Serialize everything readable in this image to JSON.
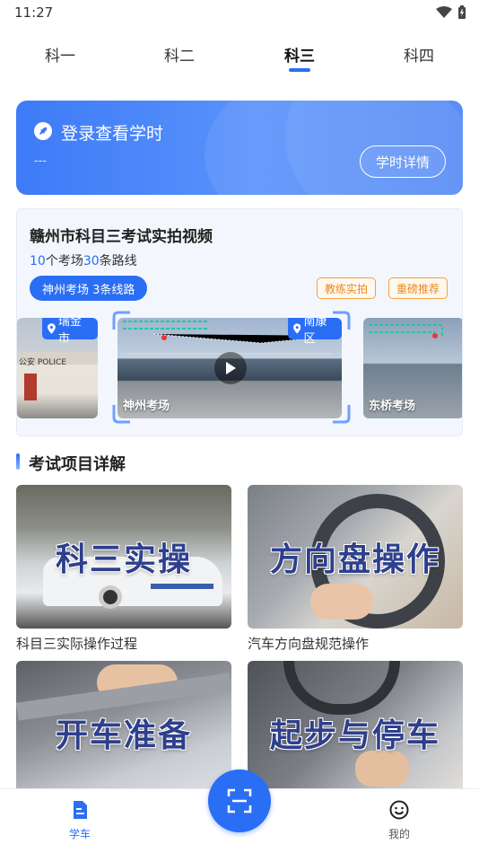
{
  "status_bar": {
    "time": "11:27"
  },
  "tabs": [
    {
      "label": "科一"
    },
    {
      "label": "科二"
    },
    {
      "label": "科三"
    },
    {
      "label": "科四"
    }
  ],
  "active_tab": "科三",
  "login_card": {
    "title": "登录查看学时",
    "subtitle": "---",
    "button": "学时详情"
  },
  "video_card": {
    "title": "赣州市科目三考试实拍视频",
    "stats": {
      "venues_count": "10",
      "venues_text": "个考场",
      "routes_count": "30",
      "routes_text": "条路线"
    },
    "pill": "神州考场 3条线路",
    "tags": [
      "教练实拍",
      "重磅推荐"
    ],
    "thumbs": [
      {
        "location": "瑞金市",
        "label": "",
        "sign": "公安 POLICE"
      },
      {
        "location": "南康区",
        "label": "神州考场"
      },
      {
        "location": "",
        "label": "东桥考场"
      }
    ]
  },
  "section": {
    "title": "考试项目详解"
  },
  "grid": [
    {
      "overlay": "科三实操",
      "caption": "科目三实际操作过程"
    },
    {
      "overlay": "方向盘操作",
      "caption": "汽车方向盘规范操作"
    },
    {
      "overlay": "开车准备",
      "caption": ""
    },
    {
      "overlay": "起步与停车",
      "caption": ""
    }
  ],
  "bottom_nav": {
    "left": {
      "label": "学车"
    },
    "right": {
      "label": "我的"
    }
  },
  "colors": {
    "accent": "#2a6ef5",
    "tag_orange": "#e98a1c"
  }
}
